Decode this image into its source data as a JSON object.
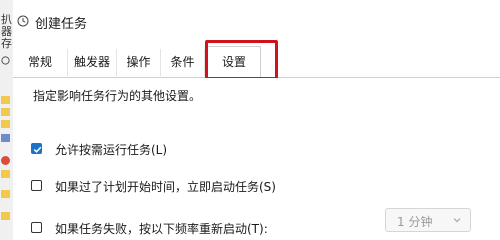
{
  "left_strip": {
    "fragments": [
      "扒",
      "器",
      "存"
    ]
  },
  "dialog": {
    "title": "创建任务",
    "tabs": [
      {
        "label": "常规",
        "active": false
      },
      {
        "label": "触发器",
        "active": false
      },
      {
        "label": "操作",
        "active": false
      },
      {
        "label": "条件",
        "active": false
      },
      {
        "label": "设置",
        "active": true
      }
    ],
    "highlight_color": "#d0121b",
    "description": "指定影响任务行为的其他设置。",
    "options": [
      {
        "label": "允许按需运行任务(L)",
        "checked": true
      },
      {
        "label": "如果过了计划开始时间，立即启动任务(S)",
        "checked": false
      },
      {
        "label": "如果任务失败，按以下频率重新启动(T):",
        "checked": false
      }
    ],
    "restart_interval": {
      "value": "1 分钟",
      "disabled": true
    }
  },
  "colors": {
    "accent": "#1a73c8",
    "highlight": "#d0121b"
  }
}
